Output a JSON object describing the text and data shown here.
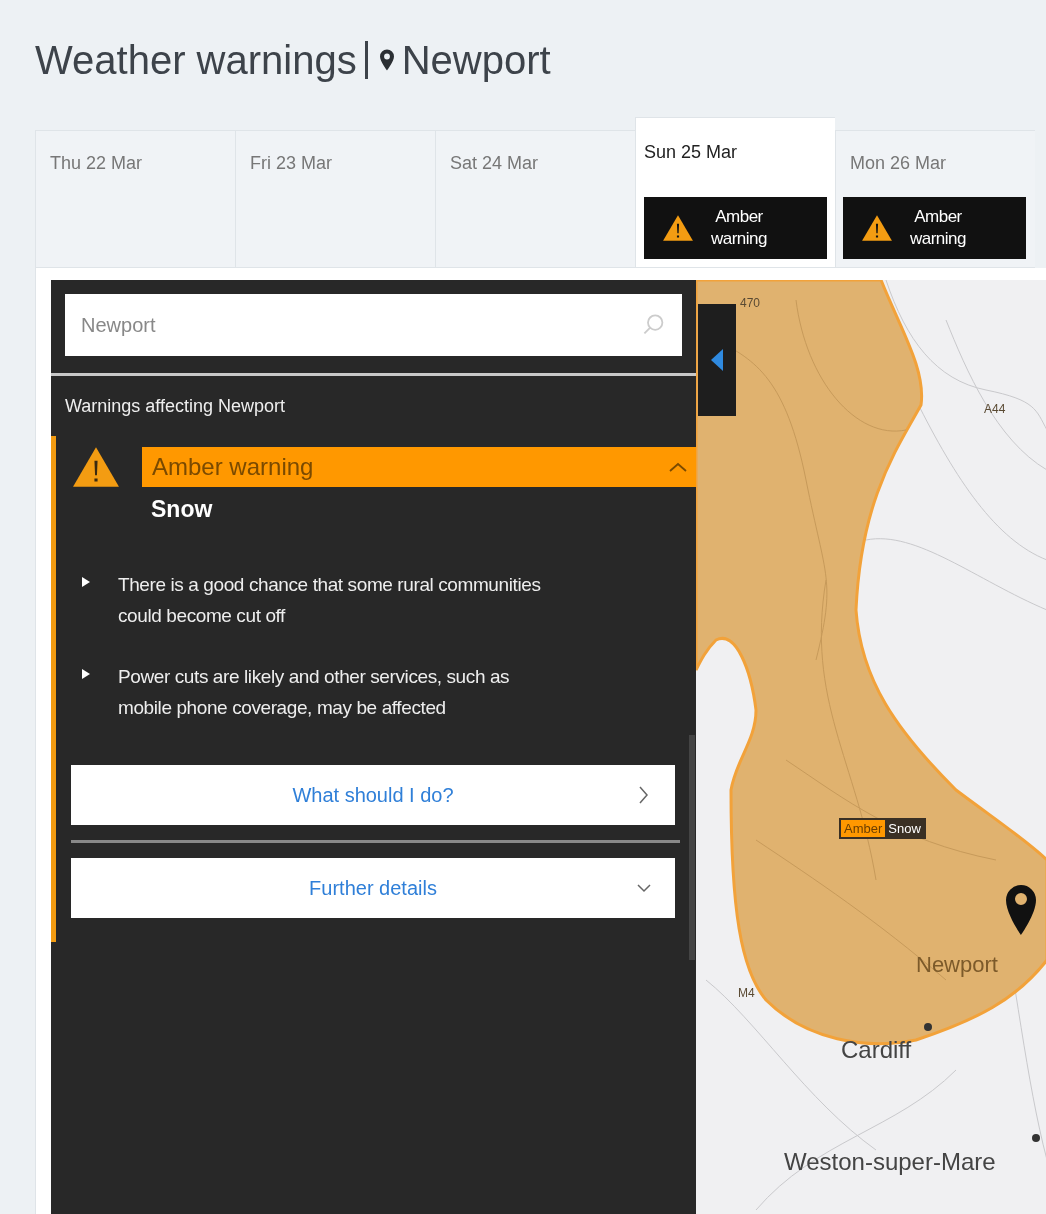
{
  "title": "Weather warnings",
  "location": "Newport",
  "tabs": [
    {
      "date": "Thu 22 Mar",
      "selected": false
    },
    {
      "date": "Fri 23 Mar",
      "selected": false
    },
    {
      "date": "Sat 24 Mar",
      "selected": false
    },
    {
      "date": "Sun 25 Mar",
      "selected": true,
      "warning": "Amber warning"
    },
    {
      "date": "Mon 26 Mar",
      "selected": false,
      "warning": "Amber warning"
    }
  ],
  "search": {
    "value": "Newport"
  },
  "warnings_heading": "Warnings affecting Newport",
  "warning": {
    "level": "Amber warning",
    "expanded": true,
    "type": "Snow",
    "impacts": [
      "There is a good chance that some rural communities could become cut off",
      "Power cuts are likely and other services, such as mobile phone coverage, may be affected"
    ],
    "links": [
      {
        "label": "What should I do?",
        "kind": "link"
      },
      {
        "label": "Further details",
        "kind": "expand"
      }
    ]
  },
  "map": {
    "badge": {
      "level": "Amber",
      "type": "Snow"
    },
    "labels": [
      {
        "text": "470",
        "kind": "road"
      },
      {
        "text": "A44",
        "kind": "road"
      },
      {
        "text": "Newport",
        "kind": "place"
      },
      {
        "text": "M4",
        "kind": "road"
      },
      {
        "text": "Cardiff",
        "kind": "city"
      },
      {
        "text": "Weston-super-Mare",
        "kind": "city"
      }
    ]
  }
}
